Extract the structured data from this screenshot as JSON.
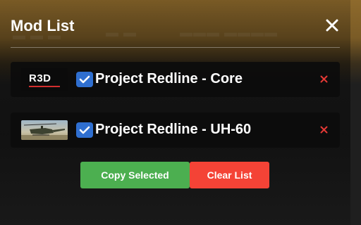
{
  "panel": {
    "title": "Mod List",
    "close_icon": "close-icon"
  },
  "mods": [
    {
      "name": "Project Redline - Core",
      "thumb_text": "R3D",
      "thumb_type": "logo",
      "checked": true,
      "remove_icon": "remove-icon"
    },
    {
      "name": "Project Redline - UH-60",
      "thumb_type": "helicopter-image",
      "checked": true,
      "remove_icon": "remove-icon"
    }
  ],
  "actions": {
    "copy_label": "Copy Selected",
    "clear_label": "Clear List"
  },
  "colors": {
    "checkbox": "#2f6fd0",
    "copy_button": "#4caf50",
    "clear_button": "#f44336",
    "remove_x": "#e53935"
  }
}
